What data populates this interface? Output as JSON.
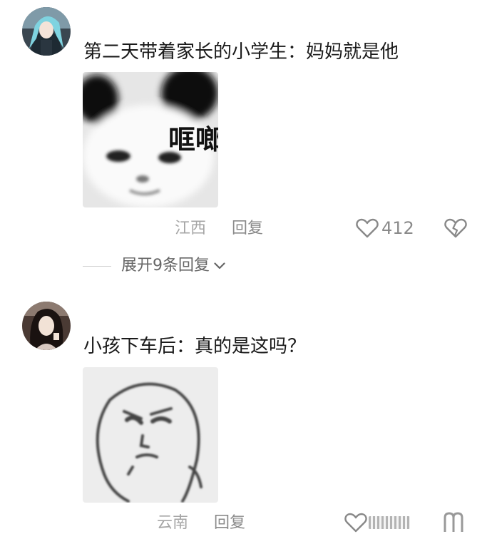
{
  "comments": [
    {
      "text": "第二天带着家长的小学生：妈妈就是他",
      "sticker_caption": "哐啷",
      "location": "江西",
      "reply_label": "回复",
      "likes": "412",
      "replies_toggle": "展开9条回复"
    },
    {
      "text": "小孩下车后：真的是这吗？",
      "location": "云南",
      "reply_label": "回复"
    }
  ],
  "icons": {
    "like": "heart-outline-icon",
    "dislike": "broken-heart-icon",
    "expand": "chevron-down-icon"
  },
  "colors": {
    "text": "#1a1a1a",
    "secondary": "#8a8a8a",
    "location": "#a5a5a5"
  }
}
